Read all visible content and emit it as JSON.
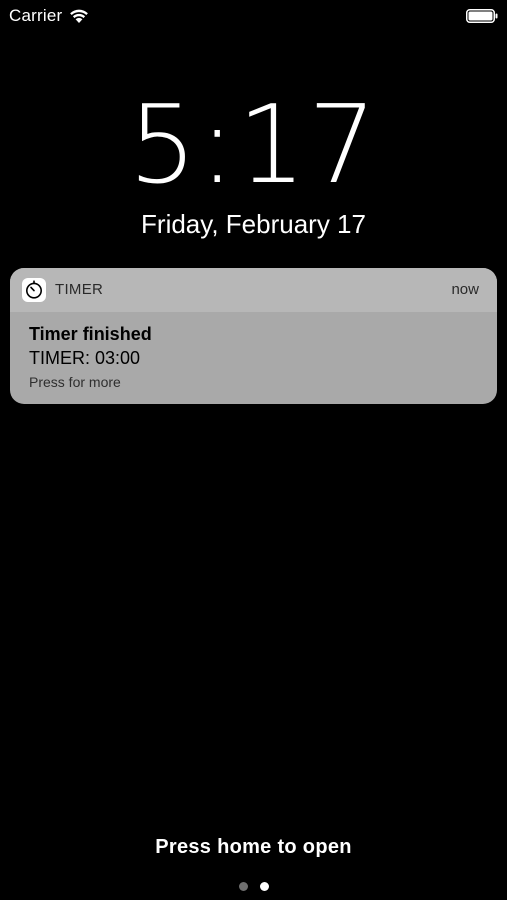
{
  "status_bar": {
    "carrier": "Carrier",
    "wifi_icon": "wifi-icon",
    "battery_icon": "battery-icon"
  },
  "lock_screen": {
    "time": "5:17",
    "date": "Friday, February 17"
  },
  "notification": {
    "app_icon": "timer-icon",
    "app_name": "TIMER",
    "time": "now",
    "title": "Timer finished",
    "message": "TIMER: 03:00",
    "action_hint": "Press for more"
  },
  "footer": {
    "prompt": "Press home to open",
    "page_dots": {
      "count": 2,
      "active_index": 1
    }
  },
  "colors": {
    "background": "#000000",
    "notification_header": "#b7b7b7",
    "notification_body": "#a9a9a9",
    "inactive_dot": "#6e6e6e"
  }
}
